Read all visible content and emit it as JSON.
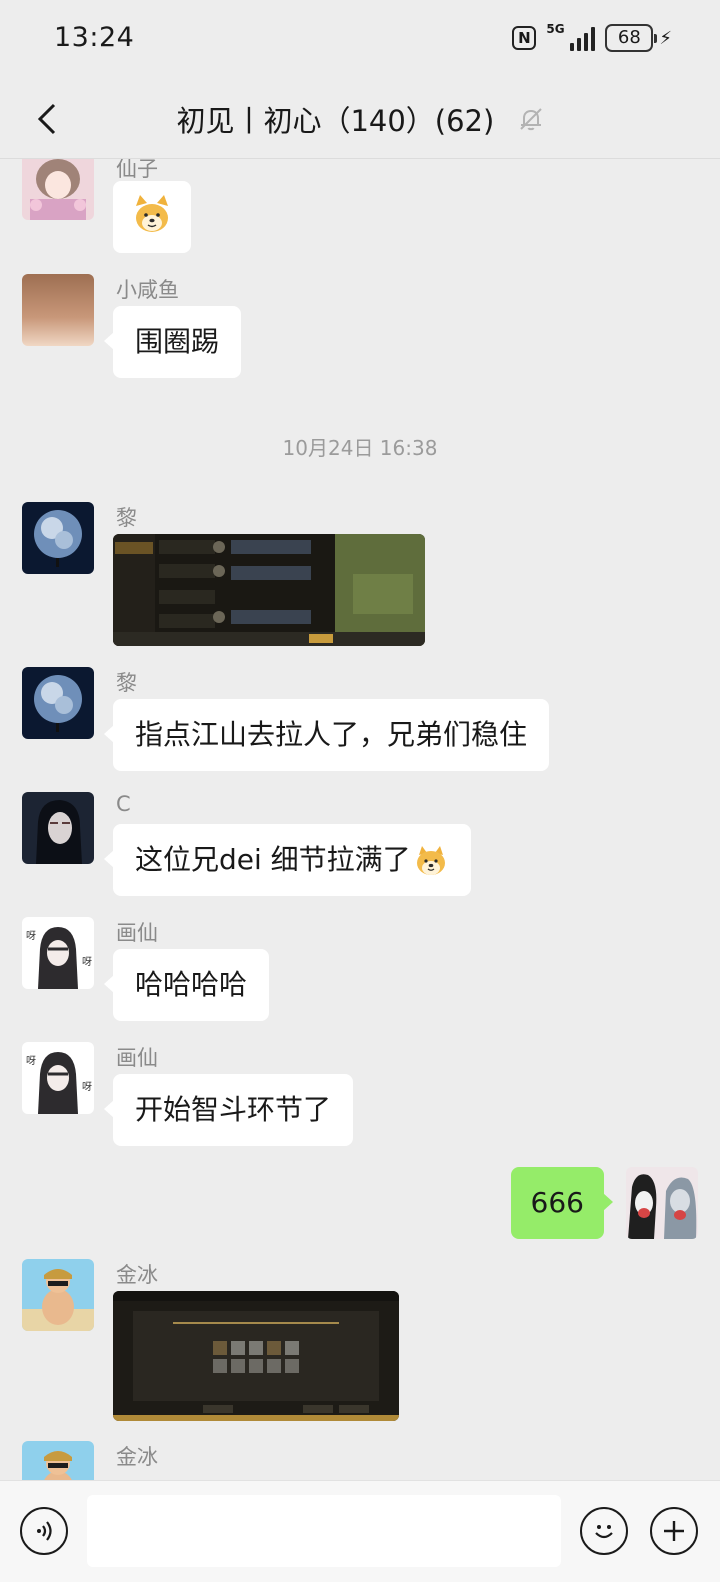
{
  "status": {
    "time": "13:24",
    "network": "5G",
    "battery": "68"
  },
  "header": {
    "title": "初见丨初心（140）(62)"
  },
  "messages": [
    {
      "sender": "仙子"
    },
    {
      "sender": "小咸鱼",
      "text": "围圈踢"
    },
    {
      "timestamp": "10月24日 16:38"
    },
    {
      "sender": "黎"
    },
    {
      "sender": "黎",
      "text": "指点江山去拉人了，兄弟们稳住"
    },
    {
      "sender": "C",
      "text": "这位兄dei 细节拉满了"
    },
    {
      "sender": "画仙",
      "text": "哈哈哈哈"
    },
    {
      "sender": "画仙",
      "text": "开始智斗环节了"
    },
    {
      "text": "666"
    },
    {
      "sender": "金冰"
    },
    {
      "sender": "金冰"
    }
  ],
  "input": {
    "value": ""
  }
}
